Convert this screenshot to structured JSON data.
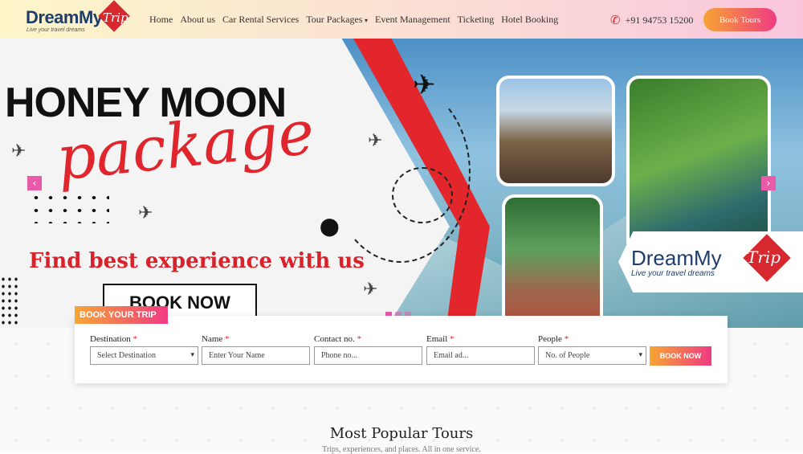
{
  "header": {
    "logo_word": "DreamMy",
    "logo_trip": "Trip",
    "logo_tagline": "Live your travel dreams",
    "nav": [
      "Home",
      "About us",
      "Car Rental Services",
      "Tour Packages",
      "Event Management",
      "Ticketing",
      "Hotel Booking"
    ],
    "phone": "+91 94753 15200",
    "book_tours": "Book Tours"
  },
  "hero": {
    "title_line1": "HONEY MOON",
    "title_line2": "package",
    "tagline": "Find best experience with us",
    "cta": "BOOK NOW",
    "logo_word": "DreamMy",
    "logo_trip": "Trip",
    "logo_tagline": "Live your travel dreams"
  },
  "booking": {
    "tab_label": "BOOK YOUR TRIP",
    "fields": [
      {
        "label": "Destination",
        "value": "Select Destination",
        "type": "select"
      },
      {
        "label": "Name",
        "placeholder": "Enter Your Name",
        "type": "input"
      },
      {
        "label": "Contact no.",
        "placeholder": "Phone no...",
        "type": "input"
      },
      {
        "label": "Email",
        "placeholder": "Email ad...",
        "type": "input"
      },
      {
        "label": "People",
        "value": "No. of People",
        "type": "select"
      }
    ],
    "required_mark": "*",
    "submit": "BOOK NOW"
  },
  "popular": {
    "title": "Most Popular Tours",
    "subtitle": "Trips, experiences, and places. All in one service."
  },
  "icons": {
    "phone": "phone-icon",
    "dropdown": "chevron-down-icon",
    "prev": "chevron-left-icon",
    "next": "chevron-right-icon"
  },
  "colors": {
    "brand_red": "#e0252c",
    "brand_navy": "#1f3d6b",
    "gradient_start": "#f7a535",
    "gradient_end": "#ef3b82"
  }
}
